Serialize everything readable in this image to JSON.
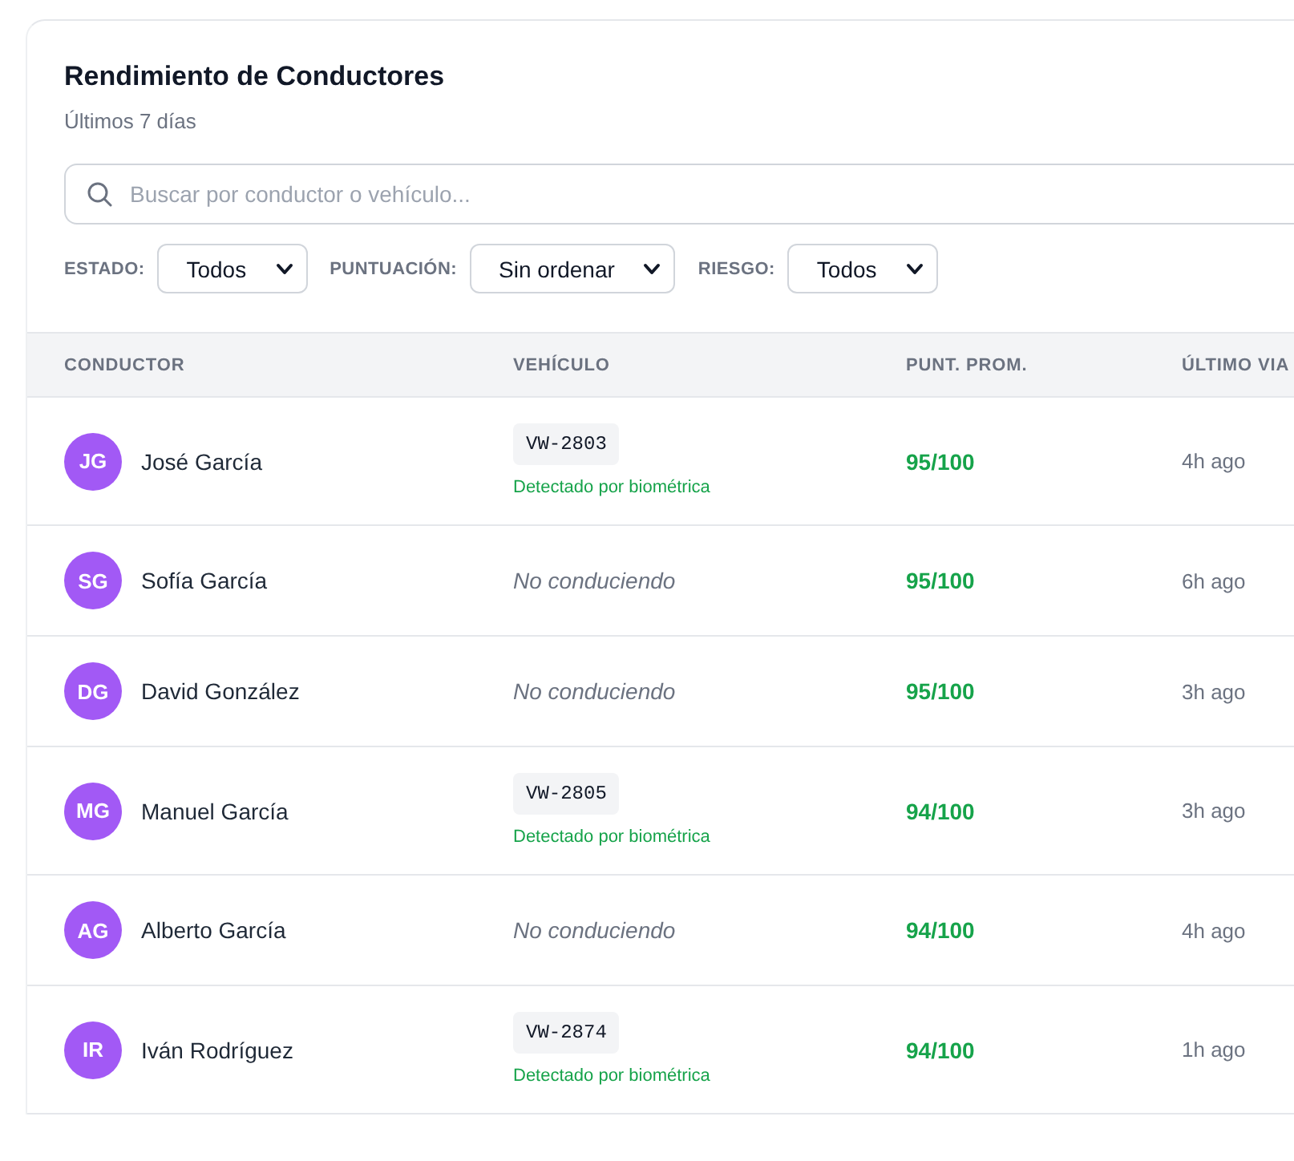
{
  "panel": {
    "title": "Rendimiento de Conductores",
    "subtitle": "Últimos 7 días"
  },
  "search": {
    "placeholder": "Buscar por conductor o vehículo..."
  },
  "filters": [
    {
      "label": "ESTADO:",
      "value": "Todos"
    },
    {
      "label": "PUNTUACIÓN:",
      "value": "Sin ordenar"
    },
    {
      "label": "RIESGO:",
      "value": "Todos"
    }
  ],
  "table": {
    "columns": [
      "CONDUCTOR",
      "VEHÍCULO",
      "PUNT. PROM.",
      "ÚLTIMO VIA"
    ],
    "rows": [
      {
        "initials": "JG",
        "name": "José García",
        "vehicle": {
          "kind": "plate",
          "plate": "VW-2803",
          "note": "Detectado por biométrica"
        },
        "score": "95/100",
        "last_trip": "4h ago"
      },
      {
        "initials": "SG",
        "name": "Sofía García",
        "vehicle": {
          "kind": "none",
          "text": "No conduciendo"
        },
        "score": "95/100",
        "last_trip": "6h ago"
      },
      {
        "initials": "DG",
        "name": "David González",
        "vehicle": {
          "kind": "none",
          "text": "No conduciendo"
        },
        "score": "95/100",
        "last_trip": "3h ago"
      },
      {
        "initials": "MG",
        "name": "Manuel García",
        "vehicle": {
          "kind": "plate",
          "plate": "VW-2805",
          "note": "Detectado por biométrica"
        },
        "score": "94/100",
        "last_trip": "3h ago"
      },
      {
        "initials": "AG",
        "name": "Alberto García",
        "vehicle": {
          "kind": "none",
          "text": "No conduciendo"
        },
        "score": "94/100",
        "last_trip": "4h ago"
      },
      {
        "initials": "IR",
        "name": "Iván Rodríguez",
        "vehicle": {
          "kind": "plate",
          "plate": "VW-2874",
          "note": "Detectado por biométrica"
        },
        "score": "94/100",
        "last_trip": "1h ago"
      }
    ]
  }
}
